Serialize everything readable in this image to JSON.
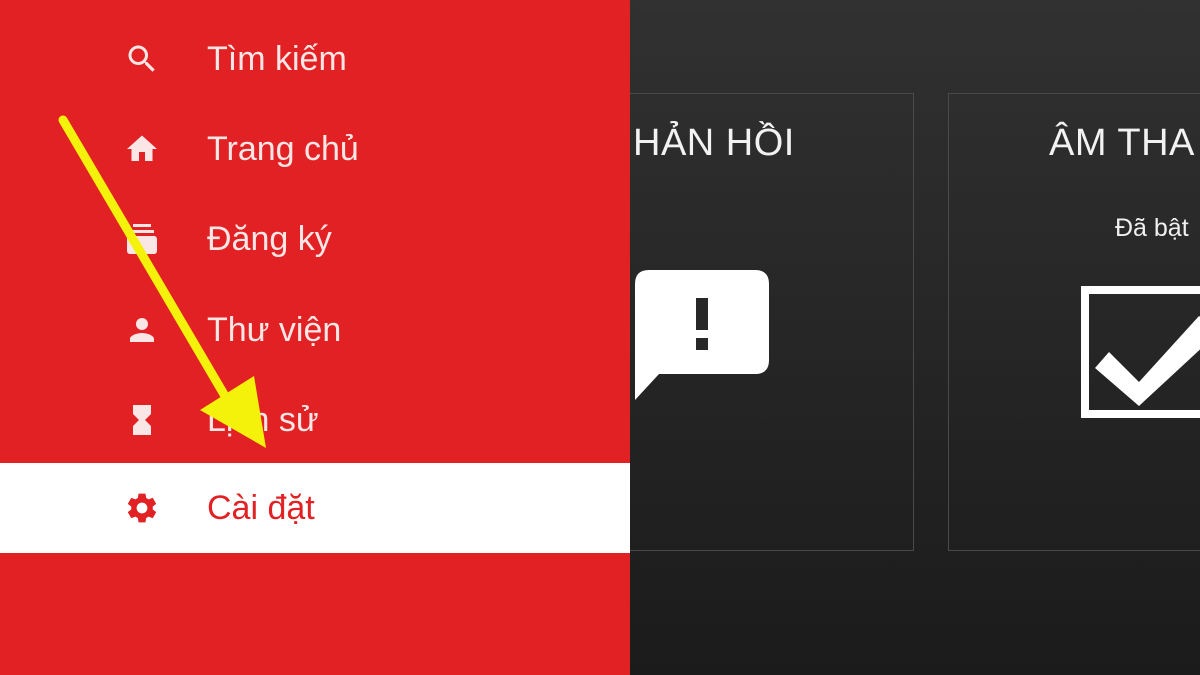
{
  "theme": {
    "drawer_background": "#e22124",
    "drawer_text": "#fbe6e6",
    "selected_background": "#ffffff",
    "selected_text": "#e22124",
    "content_background": "#262626",
    "annotation_arrow": "#f4f10a"
  },
  "nav": {
    "items": [
      {
        "label": "Tìm kiếm",
        "icon": "search-icon"
      },
      {
        "label": "Trang chủ",
        "icon": "home-icon"
      },
      {
        "label": "Đăng ký",
        "icon": "subscriptions-icon"
      },
      {
        "label": "Thư viện",
        "icon": "person-icon"
      },
      {
        "label": "Lịch sử",
        "icon": "hourglass-icon"
      },
      {
        "label": "Cài đặt",
        "icon": "gear-icon",
        "selected": true
      }
    ]
  },
  "cards": {
    "feedback": {
      "title": "HẢN HỒI",
      "icon": "feedback-icon"
    },
    "sound": {
      "title": "ÂM THA",
      "status": "Đã bật",
      "icon": "checkbox-checked-icon",
      "checked": true
    }
  },
  "annotation": {
    "type": "arrow",
    "points_to": "nav.items.5"
  }
}
